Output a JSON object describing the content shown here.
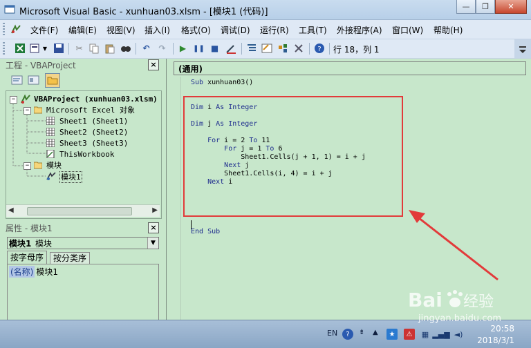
{
  "window": {
    "title": "Microsoft Visual Basic - xunhuan03.xlsm - [模块1 (代码)]",
    "controls": [
      "—",
      "❐",
      "✕"
    ]
  },
  "menus": [
    "文件(F)",
    "编辑(E)",
    "视图(V)",
    "插入(I)",
    "格式(O)",
    "调试(D)",
    "运行(R)",
    "工具(T)",
    "外接程序(A)",
    "窗口(W)",
    "帮助(H)"
  ],
  "toolbar": {
    "position_label": "行 18，列 1"
  },
  "project_panel": {
    "title": "工程 - VBAProject",
    "tree": {
      "root": "VBAProject (xunhuan03.xlsm)",
      "excel_folder": "Microsoft Excel 对象",
      "sheets": [
        "Sheet1 (Sheet1)",
        "Sheet2 (Sheet2)",
        "Sheet3 (Sheet3)"
      ],
      "workbook": "ThisWorkbook",
      "modules_folder": "模块",
      "module": "模块1"
    }
  },
  "properties_panel": {
    "title": "属性 - 模块1",
    "object_name": "模块1",
    "object_type": "模块",
    "tabs": [
      "按字母序",
      "按分类序"
    ],
    "property_key": "(名称)",
    "property_value": "模块1"
  },
  "code_window": {
    "object_dropdown": "(通用)",
    "lines": [
      "Sub xunhuan03()",
      "",
      "",
      "Dim i As Integer",
      "",
      "Dim j As Integer",
      "",
      "    For i = 2 To 11",
      "        For j = 1 To 6",
      "            Sheet1.Cells(j + 1, 1) = i + j",
      "        Next j",
      "        Sheet1.Cells(i, 4) = i + j",
      "    Next i",
      "",
      "",
      "",
      "",
      "",
      "End Sub"
    ]
  },
  "taskbar": {
    "lang": "EN",
    "time": "20:58",
    "date": "2018/3/1"
  },
  "watermark": {
    "text": "jingyan.baidu.com"
  },
  "colors": {
    "code_bg": "#c7e7cb",
    "highlight": "#e23a3a",
    "keyword": "#1d2b8d"
  }
}
